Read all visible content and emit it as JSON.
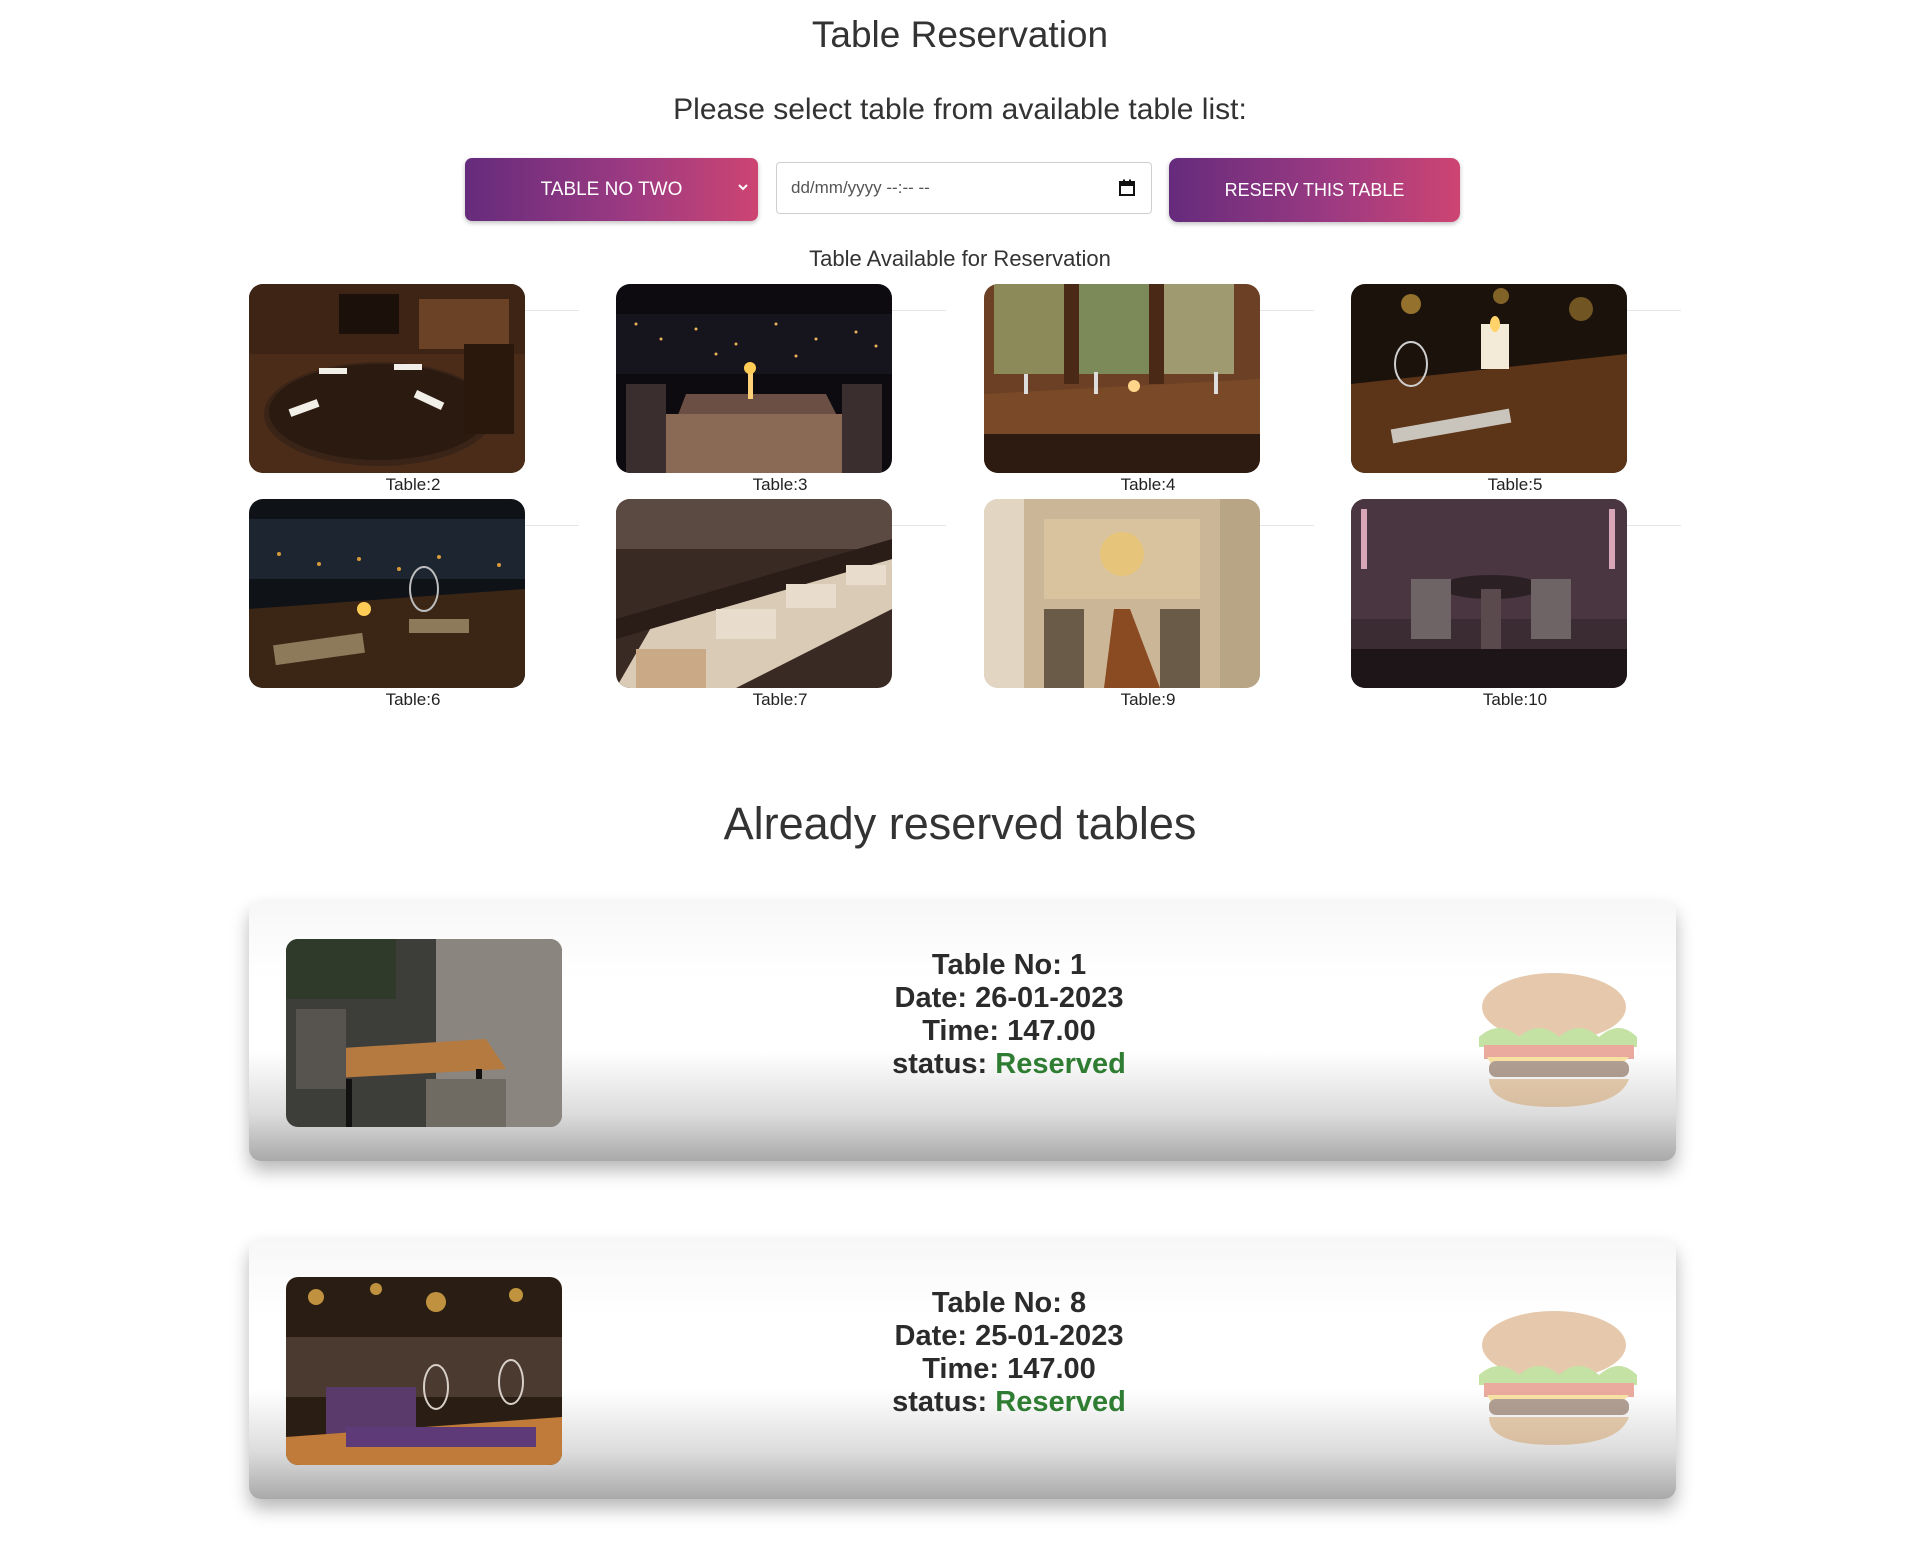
{
  "page": {
    "title": "Table Reservation",
    "subtitle": "Please select table from available table list:"
  },
  "form": {
    "table_select_value": "TABLE NO TWO",
    "datetime_placeholder": "dd/mm/yyyy --:-- --",
    "reserve_label": "RESERV THIS TABLE"
  },
  "available": {
    "heading": "Table Available for Reservation",
    "tables": [
      {
        "label": "Table:2",
        "scene": "wood-round"
      },
      {
        "label": "Table:3",
        "scene": "night-city"
      },
      {
        "label": "Table:4",
        "scene": "window-warm"
      },
      {
        "label": "Table:5",
        "scene": "candle-dark"
      },
      {
        "label": "Table:6",
        "scene": "night-candles"
      },
      {
        "label": "Table:7",
        "scene": "bright-rows"
      },
      {
        "label": "Table:9",
        "scene": "banquet"
      },
      {
        "label": "Table:10",
        "scene": "purple-room"
      }
    ]
  },
  "reserved": {
    "heading": "Already reserved tables",
    "items": [
      {
        "table_label": "Table No: 1",
        "date_label": "Date: 26-01-2023",
        "time_label": "Time: 147.00",
        "status_prefix": "status: ",
        "status": "Reserved"
      },
      {
        "table_label": "Table No: 8",
        "date_label": "Date: 25-01-2023",
        "time_label": "Time: 147.00",
        "status_prefix": "status: ",
        "status": "Reserved"
      }
    ]
  },
  "colors": {
    "gradient_start": "#652b7c",
    "gradient_end": "#cd4472",
    "status_green": "#2f7d32"
  },
  "icons": [
    "chevron-down-icon",
    "calendar-icon",
    "burger-icon"
  ]
}
